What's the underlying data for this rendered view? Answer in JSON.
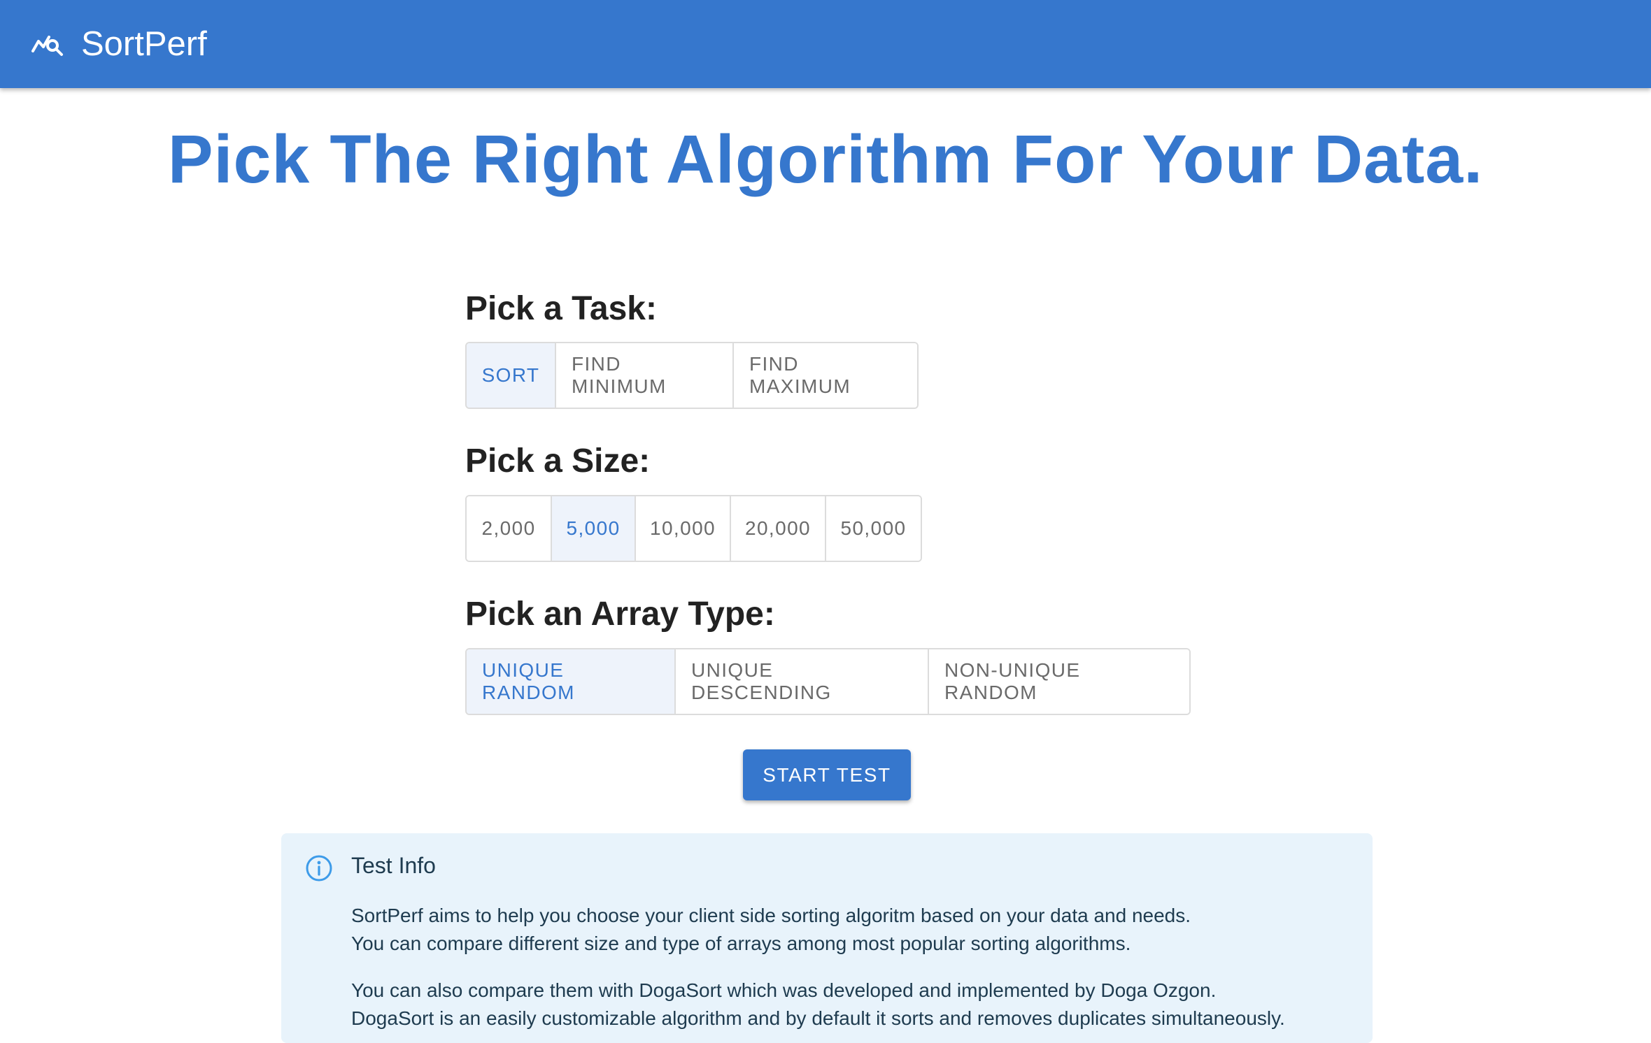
{
  "app": {
    "title": "SortPerf",
    "logo_icon": "chart-search-icon"
  },
  "colors": {
    "primary": "#3677cd",
    "selected_bg": "#eef3fb",
    "info_bg": "#e8f3fb",
    "info_icon": "#3d9be9"
  },
  "hero": {
    "heading": "Pick The Right Algorithm For Your Data."
  },
  "task": {
    "label": "Pick a Task:",
    "options": [
      "SORT",
      "FIND MINIMUM",
      "FIND MAXIMUM"
    ],
    "selected": "SORT"
  },
  "size": {
    "label": "Pick a Size:",
    "options": [
      "2,000",
      "5,000",
      "10,000",
      "20,000",
      "50,000"
    ],
    "selected": "5,000"
  },
  "array_type": {
    "label": "Pick an Array Type:",
    "options": [
      "UNIQUE RANDOM",
      "UNIQUE DESCENDING",
      "NON-UNIQUE RANDOM"
    ],
    "selected": "UNIQUE RANDOM"
  },
  "start_button": {
    "label": "START TEST"
  },
  "info": {
    "icon": "info-icon",
    "title": "Test Info",
    "paragraph1": [
      "SortPerf aims to help you choose your client side sorting algoritm based on your data and needs.",
      "You can compare different size and type of arrays among most popular sorting algorithms."
    ],
    "paragraph2": [
      "You can also compare them with DogaSort which was developed and implemented by Doga Ozgon.",
      "DogaSort is an easily customizable algorithm and by default it sorts and removes duplicates simultaneously."
    ]
  }
}
